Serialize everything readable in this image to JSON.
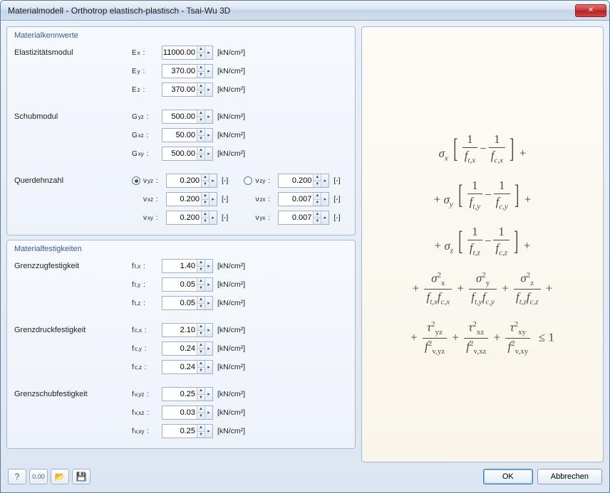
{
  "window": {
    "title": "Materialmodell - Orthotrop elastisch-plastisch - Tsai-Wu 3D",
    "close_icon": "✕"
  },
  "groups": {
    "materialkennwerte": "Materialkennwerte",
    "materialfestigkeiten": "Materialfestigkeiten"
  },
  "labels": {
    "elastizitaetsmodul": "Elastizitätsmodul",
    "schubmodul": "Schubmodul",
    "querdehnzahl": "Querdehnzahl",
    "grenzzugfestigkeit": "Grenzzugfestigkeit",
    "grenzdruckfestigkeit": "Grenzdruckfestigkeit",
    "grenzschubfestigkeit": "Grenzschubfestigkeit"
  },
  "symbols": {
    "Ex": "E",
    "Ex_sub": "x",
    "Ey": "E",
    "Ey_sub": "y",
    "Ez": "E",
    "Ez_sub": "z",
    "Gyz": "G",
    "Gyz_sub": "yz",
    "Gxz": "G",
    "Gxz_sub": "xz",
    "Gxy": "G",
    "Gxy_sub": "xy",
    "vyz": "ν",
    "vyz_sub": "yz",
    "vxz": "ν",
    "vxz_sub": "xz",
    "vxy": "ν",
    "vxy_sub": "xy",
    "vzy": "ν",
    "vzy_sub": "zy",
    "vzx": "ν",
    "vzx_sub": "zx",
    "vyx": "ν",
    "vyx_sub": "yx",
    "ftx": "f",
    "ftx_sub": "t,x",
    "fty": "f",
    "fty_sub": "t,y",
    "ftz": "f",
    "ftz_sub": "t,z",
    "fcx": "f",
    "fcx_sub": "c,x",
    "fcy": "f",
    "fcy_sub": "c,y",
    "fcz": "f",
    "fcz_sub": "c,z",
    "fvyz": "f",
    "fvyz_sub": "v,yz",
    "fvxz": "f",
    "fvxz_sub": "v,xz",
    "fvxy": "f",
    "fvxy_sub": "v,xy"
  },
  "values": {
    "Ex": "11000.00",
    "Ey": "370.00",
    "Ez": "370.00",
    "Gyz": "500.00",
    "Gxz": "50.00",
    "Gxy": "500.00",
    "vyz": "0.200",
    "vxz": "0.200",
    "vxy": "0.200",
    "vzy": "0.200",
    "vzx": "0.007",
    "vyx": "0.007",
    "ftx": "1.40",
    "fty": "0.05",
    "ftz": "0.05",
    "fcx": "2.10",
    "fcy": "0.24",
    "fcz": "0.24",
    "fvyz": "0.25",
    "fvxz": "0.03",
    "fvxy": "0.25"
  },
  "units": {
    "kncm2": "[kN/cm²]",
    "none": "[-]"
  },
  "poisson_radio": "vyz",
  "footer": {
    "ok": "OK",
    "cancel": "Abbrechen"
  },
  "spin_controls": {
    "up": "▲",
    "down": "▼",
    "ext": "▸"
  }
}
